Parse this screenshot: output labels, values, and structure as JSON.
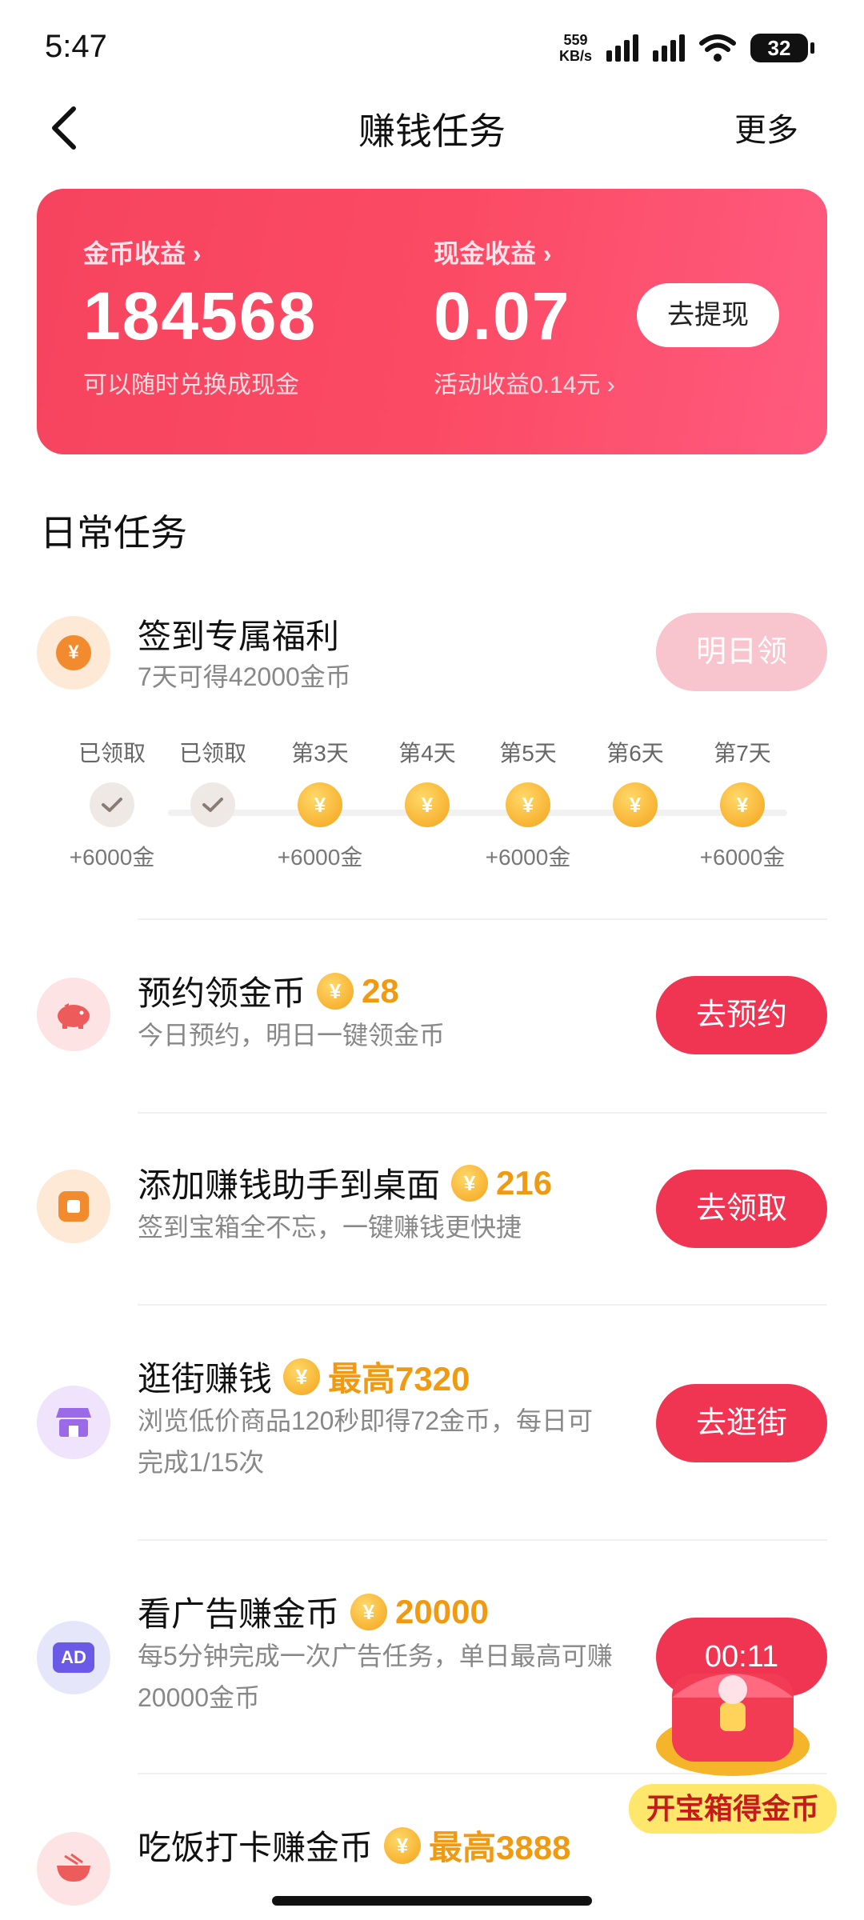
{
  "status": {
    "time": "5:47",
    "net_speed_value": "559",
    "net_speed_unit": "KB/s",
    "battery": "32"
  },
  "nav": {
    "title": "赚钱任务",
    "more": "更多"
  },
  "earnings": {
    "coin_label": "金币收益 ›",
    "coin_value": "184568",
    "coin_sub": "可以随时兑换成现金",
    "cash_label": "现金收益 ›",
    "cash_value": "0.07",
    "cash_sub": "活动收益0.14元 ›",
    "withdraw": "去提现"
  },
  "section_title": "日常任务",
  "checkin": {
    "title": "签到专属福利",
    "desc": "7天可得42000金币",
    "button": "明日领",
    "days": [
      {
        "label": "已领取",
        "state": "done",
        "reward": "+6000金"
      },
      {
        "label": "已领取",
        "state": "done",
        "reward": ""
      },
      {
        "label": "第3天",
        "state": "coin",
        "reward": "+6000金"
      },
      {
        "label": "第4天",
        "state": "coin",
        "reward": ""
      },
      {
        "label": "第5天",
        "state": "coin",
        "reward": "+6000金"
      },
      {
        "label": "第6天",
        "state": "coin",
        "reward": ""
      },
      {
        "label": "第7天",
        "state": "coin",
        "reward": "+6000金"
      }
    ]
  },
  "tasks": {
    "reserve": {
      "title": "预约领金币",
      "reward": "28",
      "desc": "今日预约，明日一键领金币",
      "button": "去预约"
    },
    "desktop": {
      "title": "添加赚钱助手到桌面",
      "reward": "216",
      "desc": "签到宝箱全不忘，一键赚钱更快捷",
      "button": "去领取"
    },
    "shop": {
      "title": "逛街赚钱",
      "reward": "最高7320",
      "desc": "浏览低价商品120秒即得72金币，每日可完成1/15次",
      "button": "去逛街"
    },
    "ad": {
      "title": "看广告赚金币",
      "reward": "20000",
      "desc": "每5分钟完成一次广告任务，单日最高可赚20000金币",
      "button": "00:11",
      "icon_text": "AD"
    },
    "meal": {
      "title": "吃饭打卡赚金币",
      "reward": "最高3888"
    }
  },
  "treasure": {
    "text": "开宝箱得金币"
  },
  "coin_symbol": "¥",
  "colors": {
    "primary": "#f03553",
    "card_start": "#f6445f",
    "card_end": "#ff5a7e",
    "reward": "#f09a12"
  }
}
